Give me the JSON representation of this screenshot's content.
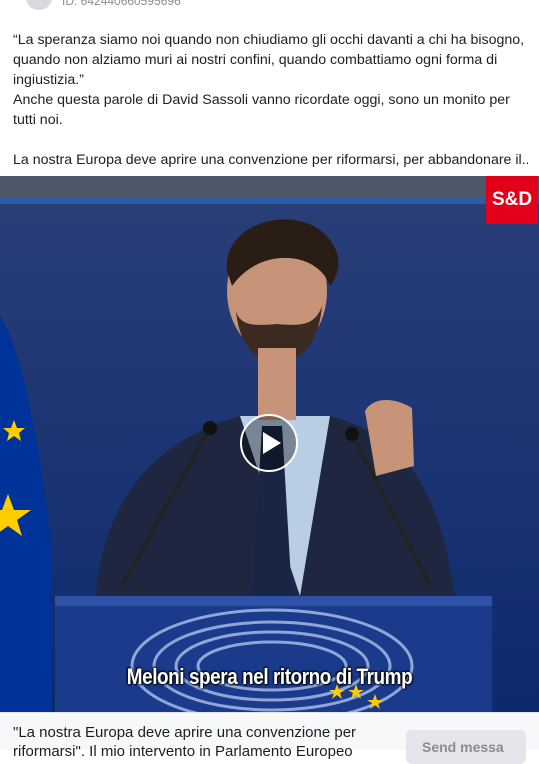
{
  "ad": {
    "id_label": "ID: 642440660595696"
  },
  "post": {
    "paragraph1": "“La speranza siamo noi quando non chiudiamo gli occhi davanti a chi ha bisogno, quando non alziamo muri ai nostri confini, quando combattiamo ogni forma di ingiustizia.”",
    "paragraph2": "Anche questa parole di David Sassoli vanno ricordate oggi, sono un monito per tutti noi.",
    "paragraph3": "La nostra Europa deve aprire una convenzione per riformarsi, per abbandonare il..."
  },
  "video": {
    "logo_text": "S&D",
    "caption": "Meloni spera nel ritorno di Trump",
    "play_icon": "play-icon"
  },
  "cta": {
    "description": "\"La nostra Europa deve aprire una convenzione per riformarsi\". Il mio intervento in Parlamento Europeo",
    "button_label": "Send messa"
  },
  "colors": {
    "logo_red": "#e2001a",
    "eu_blue": "#003399",
    "eu_star_yellow": "#ffcc00"
  }
}
